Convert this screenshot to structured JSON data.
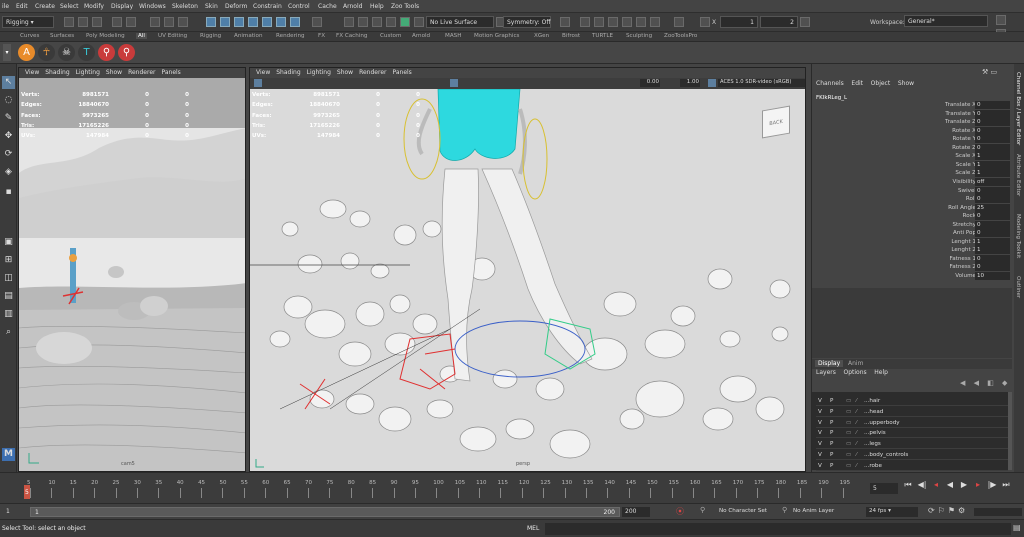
{
  "menubar": {
    "items": [
      "ile",
      "Edit",
      "Create",
      "Select",
      "Modify",
      "Display",
      "Windows",
      "Skeleton",
      "Skin",
      "Deform",
      "Constrain",
      "Control",
      "Cache",
      "Arnold",
      "Help",
      "Zoo Tools"
    ],
    "workspace_label": "Workspace:",
    "workspace_value": "General*"
  },
  "statusline": {
    "menuset": "Rigging",
    "live_surface": "No Live Surface",
    "symmetry": "Symmetry: Off",
    "field_x_label": "X",
    "field_x_value": "1",
    "field_y_value": "2"
  },
  "shelf": {
    "tabs": [
      "Curves",
      "Surfaces",
      "Poly Modeling",
      "All",
      "UV Editing",
      "Rigging",
      "Animation",
      "Rendering",
      "FX",
      "FX Caching",
      "Custom",
      "Arnold",
      "MASH",
      "Motion Graphics",
      "XGen",
      "Bifrost",
      "TURTLE",
      "Sculpting",
      "ZooToolsPro"
    ],
    "active_tab": "All"
  },
  "viewport_left": {
    "menus": [
      "View",
      "Shading",
      "Lighting",
      "Show",
      "Renderer",
      "Panels"
    ],
    "camera_label": "cam5",
    "hud": [
      {
        "label": "Verts:",
        "a": "8981571",
        "b": "0",
        "c": "0"
      },
      {
        "label": "Edges:",
        "a": "18840670",
        "b": "0",
        "c": "0"
      },
      {
        "label": "Faces:",
        "a": "9973265",
        "b": "0",
        "c": "0"
      },
      {
        "label": "Tris:",
        "a": "17165226",
        "b": "0",
        "c": "0"
      },
      {
        "label": "UVs:",
        "a": "147984",
        "b": "0",
        "c": "0"
      }
    ]
  },
  "viewport_right": {
    "menus": [
      "View",
      "Shading",
      "Lighting",
      "Show",
      "Renderer",
      "Panels"
    ],
    "camera_label": "persp",
    "value_a": "0.00",
    "value_b": "1.00",
    "color_space": "ACES 1.0 SDR-video (sRGB)",
    "viewcube_label": "BACK",
    "hud": [
      {
        "label": "Verts:",
        "a": "8981571",
        "b": "0",
        "c": "0"
      },
      {
        "label": "Edges:",
        "a": "18840670",
        "b": "0",
        "c": "0"
      },
      {
        "label": "Faces:",
        "a": "9973265",
        "b": "0",
        "c": "0"
      },
      {
        "label": "Tris:",
        "a": "17165226",
        "b": "0",
        "c": "0"
      },
      {
        "label": "UVs:",
        "a": "147984",
        "b": "0",
        "c": "0"
      }
    ]
  },
  "channel_box": {
    "menus": [
      "Channels",
      "Edit",
      "Object",
      "Show"
    ],
    "object_name": "FKIkRLeg_L",
    "attributes": [
      {
        "name": "Translate X",
        "value": "0"
      },
      {
        "name": "Translate Y",
        "value": "0"
      },
      {
        "name": "Translate Z",
        "value": "0"
      },
      {
        "name": "Rotate X",
        "value": "0"
      },
      {
        "name": "Rotate Y",
        "value": "0"
      },
      {
        "name": "Rotate Z",
        "value": "0"
      },
      {
        "name": "Scale X",
        "value": "1"
      },
      {
        "name": "Scale Y",
        "value": "1"
      },
      {
        "name": "Scale Z",
        "value": "1"
      },
      {
        "name": "Visibility",
        "value": "off"
      },
      {
        "name": "Swivel",
        "value": "0"
      },
      {
        "name": "Roll",
        "value": "0"
      },
      {
        "name": "Roll Angle",
        "value": "25"
      },
      {
        "name": "Rock",
        "value": "0"
      },
      {
        "name": "Stretchy",
        "value": "0"
      },
      {
        "name": "Anti Pop",
        "value": "0"
      },
      {
        "name": "Lenght 1",
        "value": "1"
      },
      {
        "name": "Lenght 2",
        "value": "1"
      },
      {
        "name": "Fatness 1",
        "value": "0"
      },
      {
        "name": "Fatness 2",
        "value": "0"
      },
      {
        "name": "Volume",
        "value": "10"
      }
    ]
  },
  "layer_editor": {
    "tabs": [
      "Display",
      "Anim"
    ],
    "menus": [
      "Layers",
      "Options",
      "Help"
    ],
    "layers": [
      {
        "v": "V",
        "p": "P",
        "name": "...hair"
      },
      {
        "v": "V",
        "p": "P",
        "name": "...head"
      },
      {
        "v": "V",
        "p": "P",
        "name": "...upperbody"
      },
      {
        "v": "V",
        "p": "P",
        "name": "...pelvis"
      },
      {
        "v": "V",
        "p": "P",
        "name": "...legs"
      },
      {
        "v": "V",
        "p": "P",
        "name": "...body_controls"
      },
      {
        "v": "V",
        "p": "P",
        "name": "...robe"
      }
    ]
  },
  "side_tabs": [
    "Channel Box / Layer Editor",
    "Attribute Editor",
    "Modeling Toolkit",
    "Outliner"
  ],
  "timeline": {
    "current_frame": "5",
    "frame_field": "5",
    "ticks": [
      "5",
      "10",
      "15",
      "20",
      "25",
      "30",
      "35",
      "40",
      "45",
      "50",
      "55",
      "60",
      "65",
      "70",
      "75",
      "80",
      "85",
      "90",
      "95",
      "100",
      "105",
      "110",
      "115",
      "120",
      "125",
      "130",
      "135",
      "140",
      "145",
      "150",
      "155",
      "160",
      "165",
      "170",
      "175",
      "180",
      "185",
      "190",
      "195"
    ]
  },
  "range": {
    "start": "1",
    "start_inner": "1",
    "end_inner": "200",
    "end": "200",
    "character_set": "No Character Set",
    "anim_layer": "No Anim Layer",
    "fps": "24 fps"
  },
  "command": {
    "help_text": "Select Tool: select an object",
    "mel_label": "MEL"
  }
}
